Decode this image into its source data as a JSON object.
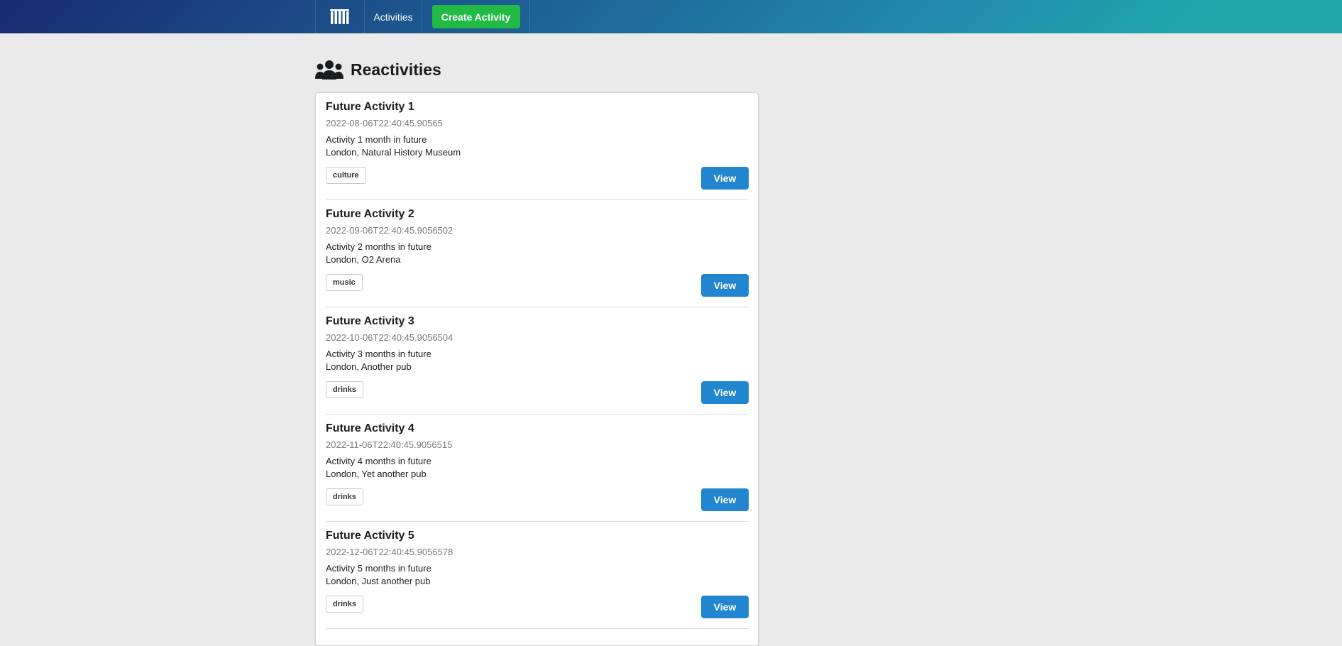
{
  "navbar": {
    "logo_icon": "logo-icon",
    "activities_label": "Activities",
    "create_label": "Create Activity",
    "colors": {
      "gradient_start": "#182a73",
      "gradient_end": "#20a7ac",
      "create_button": "#21ba45"
    }
  },
  "header": {
    "icon": "users-icon",
    "title": "Reactivities"
  },
  "activities": [
    {
      "title": "Future Activity 1",
      "date": "2022-08-06T22:40:45.90565",
      "description": "Activity 1 month in future",
      "venue": "London, Natural History Museum",
      "category": "culture",
      "view_label": "View"
    },
    {
      "title": "Future Activity 2",
      "date": "2022-09-06T22:40:45.9056502",
      "description": "Activity 2 months in future",
      "venue": "London, O2 Arena",
      "category": "music",
      "view_label": "View"
    },
    {
      "title": "Future Activity 3",
      "date": "2022-10-06T22:40:45.9056504",
      "description": "Activity 3 months in future",
      "venue": "London, Another pub",
      "category": "drinks",
      "view_label": "View"
    },
    {
      "title": "Future Activity 4",
      "date": "2022-11-06T22:40:45.9056515",
      "description": "Activity 4 months in future",
      "venue": "London, Yet another pub",
      "category": "drinks",
      "view_label": "View"
    },
    {
      "title": "Future Activity 5",
      "date": "2022-12-06T22:40:45.9056578",
      "description": "Activity 5 months in future",
      "venue": "London, Just another pub",
      "category": "drinks",
      "view_label": "View"
    }
  ],
  "colors": {
    "view_button": "#2185d0",
    "page_background": "#eaeaea"
  }
}
